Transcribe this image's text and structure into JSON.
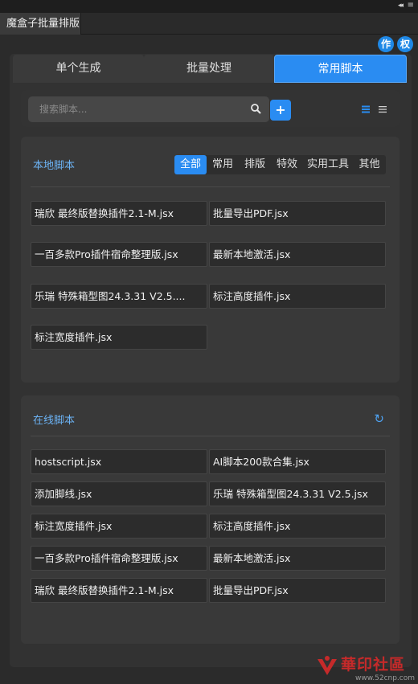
{
  "panel": {
    "tab_title": "魔盒子批量排版",
    "collapse_glyph": "◂◂",
    "menu_glyph": "≡"
  },
  "badges": [
    "作",
    "权"
  ],
  "tabs": [
    {
      "label": "单个生成",
      "active": false
    },
    {
      "label": "批量处理",
      "active": false
    },
    {
      "label": "常用脚本",
      "active": true
    }
  ],
  "search": {
    "placeholder": "搜索脚本...",
    "value": "",
    "add_label": "+"
  },
  "local": {
    "title": "本地脚本",
    "filters": [
      {
        "label": "全部",
        "active": true
      },
      {
        "label": "常用",
        "active": false
      },
      {
        "label": "排版",
        "active": false
      },
      {
        "label": "特效",
        "active": false
      },
      {
        "label": "实用工具",
        "active": false
      },
      {
        "label": "其他",
        "active": false
      }
    ],
    "items": [
      "瑞欣 最终版替换插件2.1-M.jsx",
      "批量导出PDF.jsx",
      "一百多款Pro插件宿命整理版.jsx",
      "最新本地激活.jsx",
      "乐瑞 特殊箱型图24.3.31 V2.5....",
      "标注高度插件.jsx",
      "标注宽度插件.jsx"
    ]
  },
  "online": {
    "title": "在线脚本",
    "refresh_glyph": "↻",
    "items": [
      "hostscript.jsx",
      "AI脚本200款合集.jsx",
      "添加脚线.jsx",
      "乐瑞 特殊箱型图24.3.31 V2.5.jsx",
      "标注宽度插件.jsx",
      "标注高度插件.jsx",
      "一百多款Pro插件宿命整理版.jsx",
      "最新本地激活.jsx",
      "瑞欣 最终版替换插件2.1-M.jsx",
      "批量导出PDF.jsx"
    ]
  },
  "watermark": {
    "text": "華印社區",
    "sub": "www.52cnp.com"
  },
  "colors": {
    "accent": "#2a8cf2",
    "title_blue": "#6cb3f5",
    "background": "#2b2b2b"
  }
}
